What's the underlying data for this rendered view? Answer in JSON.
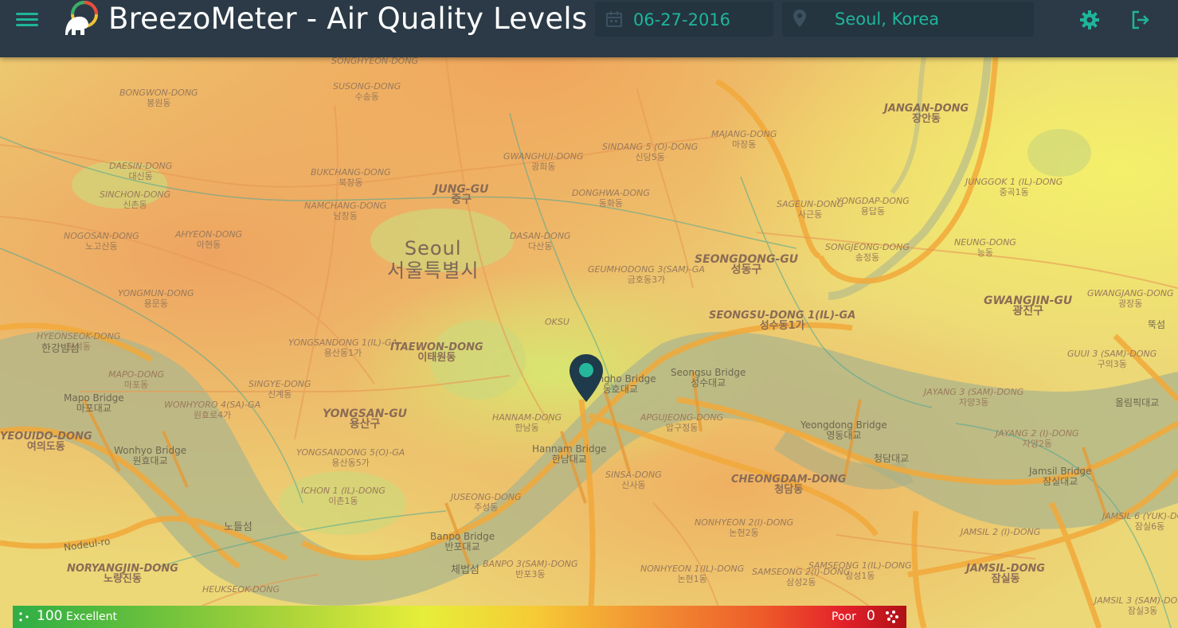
{
  "header": {
    "title": "BreezoMeter - Air Quality Levels",
    "date": "06-27-2016",
    "location": "Seoul, Korea",
    "icons": [
      "menu-icon",
      "breezometer-logo",
      "calendar-icon",
      "location-pin-icon",
      "gear-icon",
      "logout-icon"
    ],
    "accent_color": "#1fb59a",
    "bar_color": "#2b3a46"
  },
  "map": {
    "city": {
      "name": "Seoul",
      "korean": "서울특별시"
    },
    "districts": [
      {
        "name": "JUNG-GU",
        "korean": "중구"
      },
      {
        "name": "YONGSAN-GU",
        "korean": "용산구"
      },
      {
        "name": "SEONGDONG-GU",
        "korean": "성동구"
      },
      {
        "name": "GWANGJIN-GU",
        "korean": "광진구"
      }
    ],
    "neighborhoods": [
      {
        "name": "SONGHYEON-DONG",
        "korean": ""
      },
      {
        "name": "SUSONG-DONG",
        "korean": "수송동"
      },
      {
        "name": "BONGWON-DONG",
        "korean": "봉원동"
      },
      {
        "name": "DAESIN-DONG",
        "korean": "대신동"
      },
      {
        "name": "SINCHON-DONG",
        "korean": "신촌동"
      },
      {
        "name": "NOGOSAN-DONG",
        "korean": "노고산동"
      },
      {
        "name": "AHYEON-DONG",
        "korean": "아현동"
      },
      {
        "name": "BUKCHANG-DONG",
        "korean": "북창동"
      },
      {
        "name": "NAMCHANG-DONG",
        "korean": "남창동"
      },
      {
        "name": "GWANGHUI-DONG",
        "korean": "광희동"
      },
      {
        "name": "SINDANG 5 (O)-DONG",
        "korean": "신당5동"
      },
      {
        "name": "DONGHWA-DONG",
        "korean": "동화동"
      },
      {
        "name": "DASAN-DONG",
        "korean": "다산동"
      },
      {
        "name": "GEUMHODONG 3(SAM)-GA",
        "korean": "금호동3가"
      },
      {
        "name": "MAJANG-DONG",
        "korean": "마장동"
      },
      {
        "name": "SAGEUN-DONG",
        "korean": "사근동"
      },
      {
        "name": "JANGAN-DONG",
        "korean": "장안동"
      },
      {
        "name": "YONGDAP-DONG",
        "korean": "용답동"
      },
      {
        "name": "SONGJEONG-DONG",
        "korean": "송정동"
      },
      {
        "name": "JUNGGOK 1 (IL)-DONG",
        "korean": "중곡1동"
      },
      {
        "name": "NEUNG-DONG",
        "korean": "능동"
      },
      {
        "name": "YONGMUN-DONG",
        "korean": "용문동"
      },
      {
        "name": "HYEONSEOK-DONG",
        "korean": "현석동"
      },
      {
        "name": "MAPO-DONG",
        "korean": "마포동"
      },
      {
        "name": "WONHYORO 4(SA)-GA",
        "korean": "원효로4가"
      },
      {
        "name": "SINGYE-DONG",
        "korean": "신계동"
      },
      {
        "name": "YONGSANDONG 1(IL)-GA",
        "korean": "용산동1가"
      },
      {
        "name": "ITAEWON-DONG",
        "korean": "이태원동"
      },
      {
        "name": "SEONGSU-DONG 1(IL)-GA",
        "korean": "성수동1가"
      },
      {
        "name": "HANNAM-DONG",
        "korean": "한남동"
      },
      {
        "name": "APGUJEONG-DONG",
        "korean": "압구정동"
      },
      {
        "name": "YEOUIDO-DONG",
        "korean": "여의도동"
      },
      {
        "name": "YONGSANDONG 5(O)-GA",
        "korean": "용산동5가"
      },
      {
        "name": "ICHON 1 (IL)-DONG",
        "korean": "이촌1동"
      },
      {
        "name": "JUSEONG-DONG",
        "korean": "주성동"
      },
      {
        "name": "SINSA-DONG",
        "korean": "신사동"
      },
      {
        "name": "CHEONGDAM-DONG",
        "korean": "청담동"
      },
      {
        "name": "JAYANG 3 (SAM)-DONG",
        "korean": "자양3동"
      },
      {
        "name": "JAYANG 2 (I)-DONG",
        "korean": "자양2동"
      },
      {
        "name": "GUUI 3 (SAM)-DONG",
        "korean": "구의3동"
      },
      {
        "name": "GWANGJANG-DONG",
        "korean": "광장동"
      },
      {
        "name": "NONHYEON 2(I)-DONG",
        "korean": "논현2동"
      },
      {
        "name": "NONHYEON 1(IL)-DONG",
        "korean": "논현1동"
      },
      {
        "name": "SAMSEONG 2(I)-DONG",
        "korean": "삼성2동"
      },
      {
        "name": "SAMSEONG 1(IL)-DONG",
        "korean": "삼성1동"
      },
      {
        "name": "BANPO 3(SAM)-DONG",
        "korean": "반포3동"
      },
      {
        "name": "NORYANGJIN-DONG",
        "korean": "노량진동"
      },
      {
        "name": "HEUKSEOK-DONG",
        "korean": ""
      },
      {
        "name": "JAMSIL-DONG",
        "korean": "잠실동"
      },
      {
        "name": "JAMSIL 2 (I)-DONG",
        "korean": ""
      },
      {
        "name": "JAMSIL 6 (YUK)-DONG",
        "korean": "잠실6동"
      },
      {
        "name": "JAMSIL 3 (SAM)-DONG",
        "korean": "잠실3동"
      },
      {
        "name": "OKSU",
        "korean": ""
      }
    ],
    "bridges": [
      {
        "name": "Mapo Bridge",
        "korean": "마포대교"
      },
      {
        "name": "Wonhyo Bridge",
        "korean": "원효대교"
      },
      {
        "name": "Dongho Bridge",
        "korean": "동호대교"
      },
      {
        "name": "Seongsu Bridge",
        "korean": "성수대교"
      },
      {
        "name": "Hannam Bridge",
        "korean": "한남대교"
      },
      {
        "name": "Banpo Bridge",
        "korean": "반포대교"
      },
      {
        "name": "Yeongdong Bridge",
        "korean": "영동대교"
      },
      {
        "name": "Jamsil Bridge",
        "korean": "잠실대교"
      }
    ],
    "other_labels": [
      {
        "name": "Nodeul-ro"
      },
      {
        "korean": "한강밤섬"
      },
      {
        "korean": "노들섬"
      },
      {
        "korean": "체법섬"
      },
      {
        "korean": "청담대교"
      },
      {
        "korean": "올림픽대교"
      },
      {
        "korean": "뚝섬"
      }
    ],
    "marker_icon": "map-marker-icon"
  },
  "legend": {
    "max_value": "100",
    "max_label": "Excellent",
    "min_label": "Poor",
    "min_value": "0",
    "colors": [
      "#2fae46",
      "#a9d33a",
      "#e6ee39",
      "#f6cc36",
      "#f29633",
      "#ee5a2a",
      "#e3202a",
      "#b01116"
    ]
  }
}
